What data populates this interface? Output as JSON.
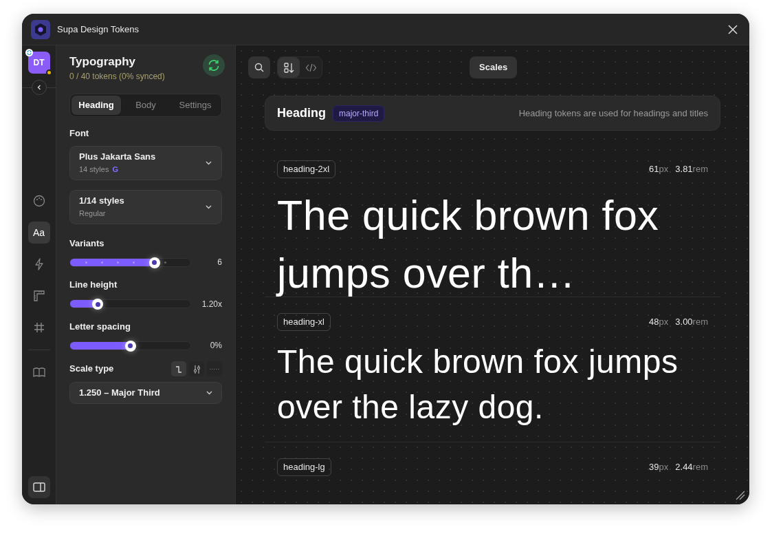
{
  "window": {
    "title": "Supa Design Tokens"
  },
  "rail": {
    "avatar": "DT",
    "items": [
      {
        "kind": "palette",
        "selected": false
      },
      {
        "kind": "text",
        "label": "Aa",
        "selected": true
      },
      {
        "kind": "bolt",
        "selected": false
      },
      {
        "kind": "ruler",
        "selected": false
      },
      {
        "kind": "grid",
        "selected": false
      },
      {
        "kind": "book",
        "selected": false
      }
    ]
  },
  "panel": {
    "title": "Typography",
    "subtitle": "0 / 40 tokens (0% synced)",
    "tabs": [
      {
        "label": "Heading",
        "selected": true
      },
      {
        "label": "Body",
        "selected": false
      },
      {
        "label": "Settings",
        "selected": false
      }
    ],
    "font_label": "Font",
    "font_select": {
      "value": "Plus Jakarta Sans",
      "detail": "14 styles",
      "source": "G"
    },
    "style_select": {
      "value": "1/14 styles",
      "detail": "Regular"
    },
    "sliders": [
      {
        "label": "Variants",
        "kind": "steps",
        "level": 0.7,
        "reading": "6"
      },
      {
        "label": "Line height",
        "kind": "plain",
        "level": 0.23,
        "reading": "1.20x"
      },
      {
        "label": "Letter spacing",
        "kind": "plain",
        "level": 0.5,
        "reading": "0%"
      }
    ],
    "scale_type": {
      "label": "Scale type",
      "modes": [
        {
          "kind": "steps",
          "selected": true
        },
        {
          "kind": "sliders",
          "selected": false
        },
        {
          "kind": "custom",
          "selected": false
        }
      ],
      "value": "1.250 – Major Third"
    }
  },
  "toolbar": {
    "view_modes": [
      {
        "kind": "list",
        "selected": true
      },
      {
        "kind": "code",
        "selected": false
      }
    ],
    "scales_button": "Scales"
  },
  "section": {
    "title": "Heading",
    "badge": "major-third",
    "description": "Heading tokens are used for headings and titles"
  },
  "tokens": [
    {
      "name": "heading-2xl",
      "measures": [
        {
          "value": "61",
          "unit": "px"
        },
        {
          "value": "3.81",
          "unit": "rem"
        }
      ],
      "sample": "The quick brown fox jumps over th…"
    },
    {
      "name": "heading-xl",
      "measures": [
        {
          "value": "48",
          "unit": "px"
        },
        {
          "value": "3.00",
          "unit": "rem"
        }
      ],
      "sample": "The quick brown fox jumps over the lazy dog."
    },
    {
      "name": "heading-lg",
      "measures": [
        {
          "value": "39",
          "unit": "px"
        },
        {
          "value": "2.44",
          "unit": "rem"
        }
      ]
    }
  ]
}
